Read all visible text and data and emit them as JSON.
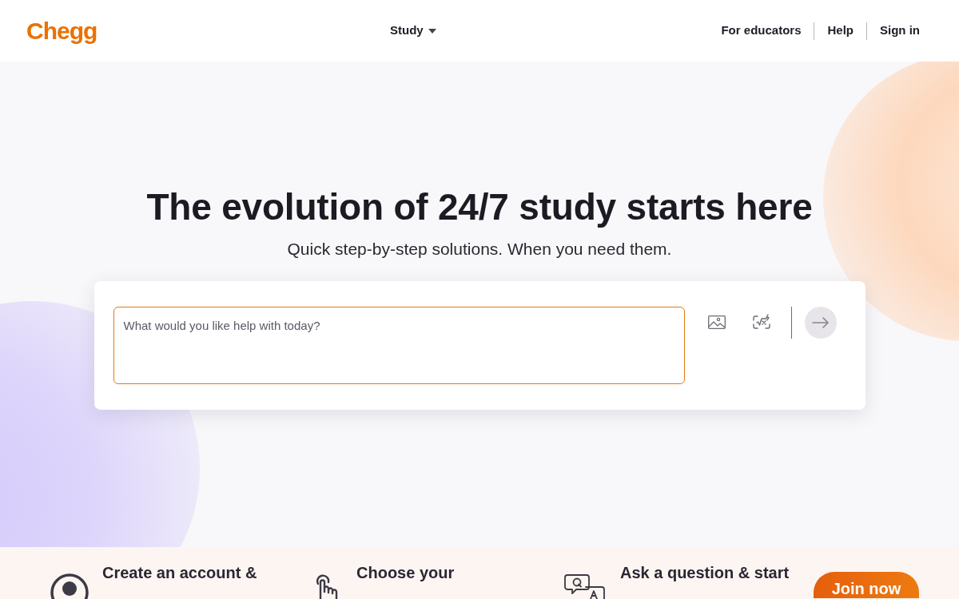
{
  "header": {
    "logo": "Chegg",
    "study_menu": {
      "label": "Study"
    },
    "links": [
      "For educators",
      "Help",
      "Sign in"
    ]
  },
  "hero": {
    "title": "The evolution of 24/7 study starts here",
    "subtitle": "Quick step-by-step solutions. When you need them.",
    "search": {
      "placeholder": "What would you like help with today?"
    }
  },
  "steps": [
    {
      "kind": "account",
      "text": "Create an account &"
    },
    {
      "kind": "choose",
      "text": "Choose your"
    },
    {
      "kind": "ask",
      "text": "Ask a question & start"
    }
  ],
  "cta": {
    "label": "Join now"
  }
}
